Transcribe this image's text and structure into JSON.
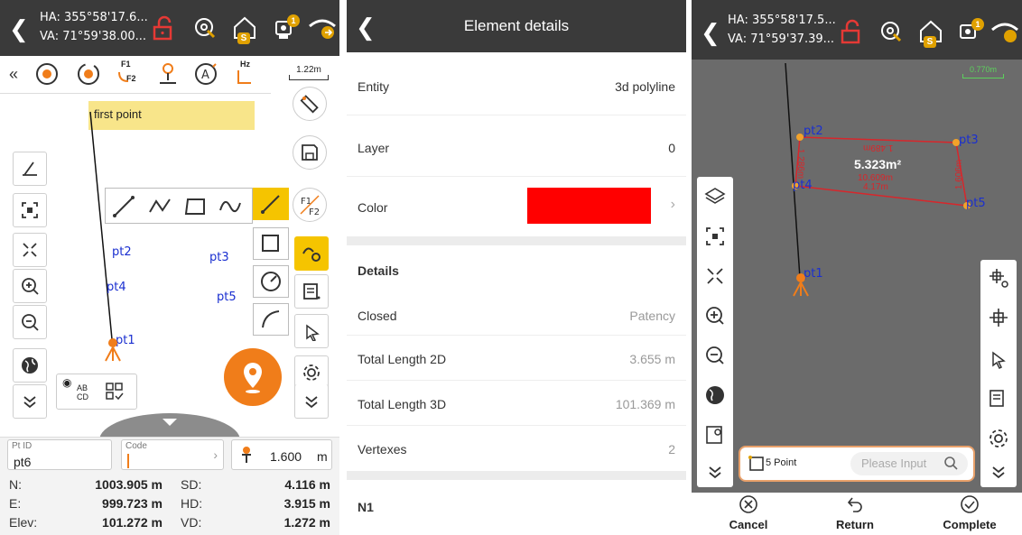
{
  "left": {
    "ha": "HA: 355°58'17.6...",
    "va": "VA: 71°59'38.00...",
    "scale": "1.22m",
    "hz_label": "Hz",
    "f1f2_top": "F1",
    "f1f2_bottom": "F2",
    "hint": "first point",
    "points": {
      "pt1": "pt1",
      "pt2": "pt2",
      "pt3": "pt3",
      "pt4": "pt4",
      "pt5": "pt5"
    },
    "ptid_label": "Pt ID",
    "ptid_value": "pt6",
    "code_label": "Code",
    "code_value": "",
    "height_value": "1.600",
    "height_unit": "m",
    "readout": {
      "n_label": "N:",
      "n_value": "1003.905 m",
      "e_label": "E:",
      "e_value": "999.723 m",
      "elev_label": "Elev:",
      "elev_value": "101.272 m",
      "sd_label": "SD:",
      "sd_value": "4.116 m",
      "hd_label": "HD:",
      "hd_value": "3.915 m",
      "vd_label": "VD:",
      "vd_value": "1.272 m"
    },
    "ab_label": "AB",
    "cd_label": "CD",
    "s_badge": "S",
    "bell_badge": "1"
  },
  "middle": {
    "title": "Element details",
    "rows": [
      {
        "label": "Entity",
        "value": "3d polyline"
      },
      {
        "label": "Layer",
        "value": "0"
      },
      {
        "label": "Color",
        "value": ""
      },
      {
        "label": "Details",
        "value": ""
      },
      {
        "label": "Closed",
        "value": "Patency"
      },
      {
        "label": "Total Length 2D",
        "value": "3.655 m"
      },
      {
        "label": "Total Length 3D",
        "value": "101.369 m"
      },
      {
        "label": "Vertexes",
        "value": "2"
      },
      {
        "label": "N1",
        "value": ""
      }
    ],
    "color_swatch": "#ff0000"
  },
  "right": {
    "ha": "HA: 355°58'17.5...",
    "va": "VA: 71°59'37.39...",
    "scale": "0.770m",
    "area": "5.323m²",
    "len1": "10.609m",
    "len2": "4.17m",
    "side_top": "1.489m",
    "side_left": "1.286m",
    "side_right": "1.606m",
    "points": {
      "pt1": "pt1",
      "pt2": "pt2",
      "pt3": "pt3",
      "pt4": "pt4",
      "pt5": "pt5"
    },
    "point_count": "5 Point",
    "search_placeholder": "Please Input",
    "cancel": "Cancel",
    "return": "Return",
    "complete": "Complete",
    "s_badge": "S",
    "bell_badge": "1"
  },
  "colors": {
    "topbar": "#3a3a3a",
    "accent": "#f07d1a",
    "active": "#f5c400",
    "polygon": "#d8262b",
    "point_label": "#1a2fd0",
    "map_dark": "#6b6b6b"
  }
}
